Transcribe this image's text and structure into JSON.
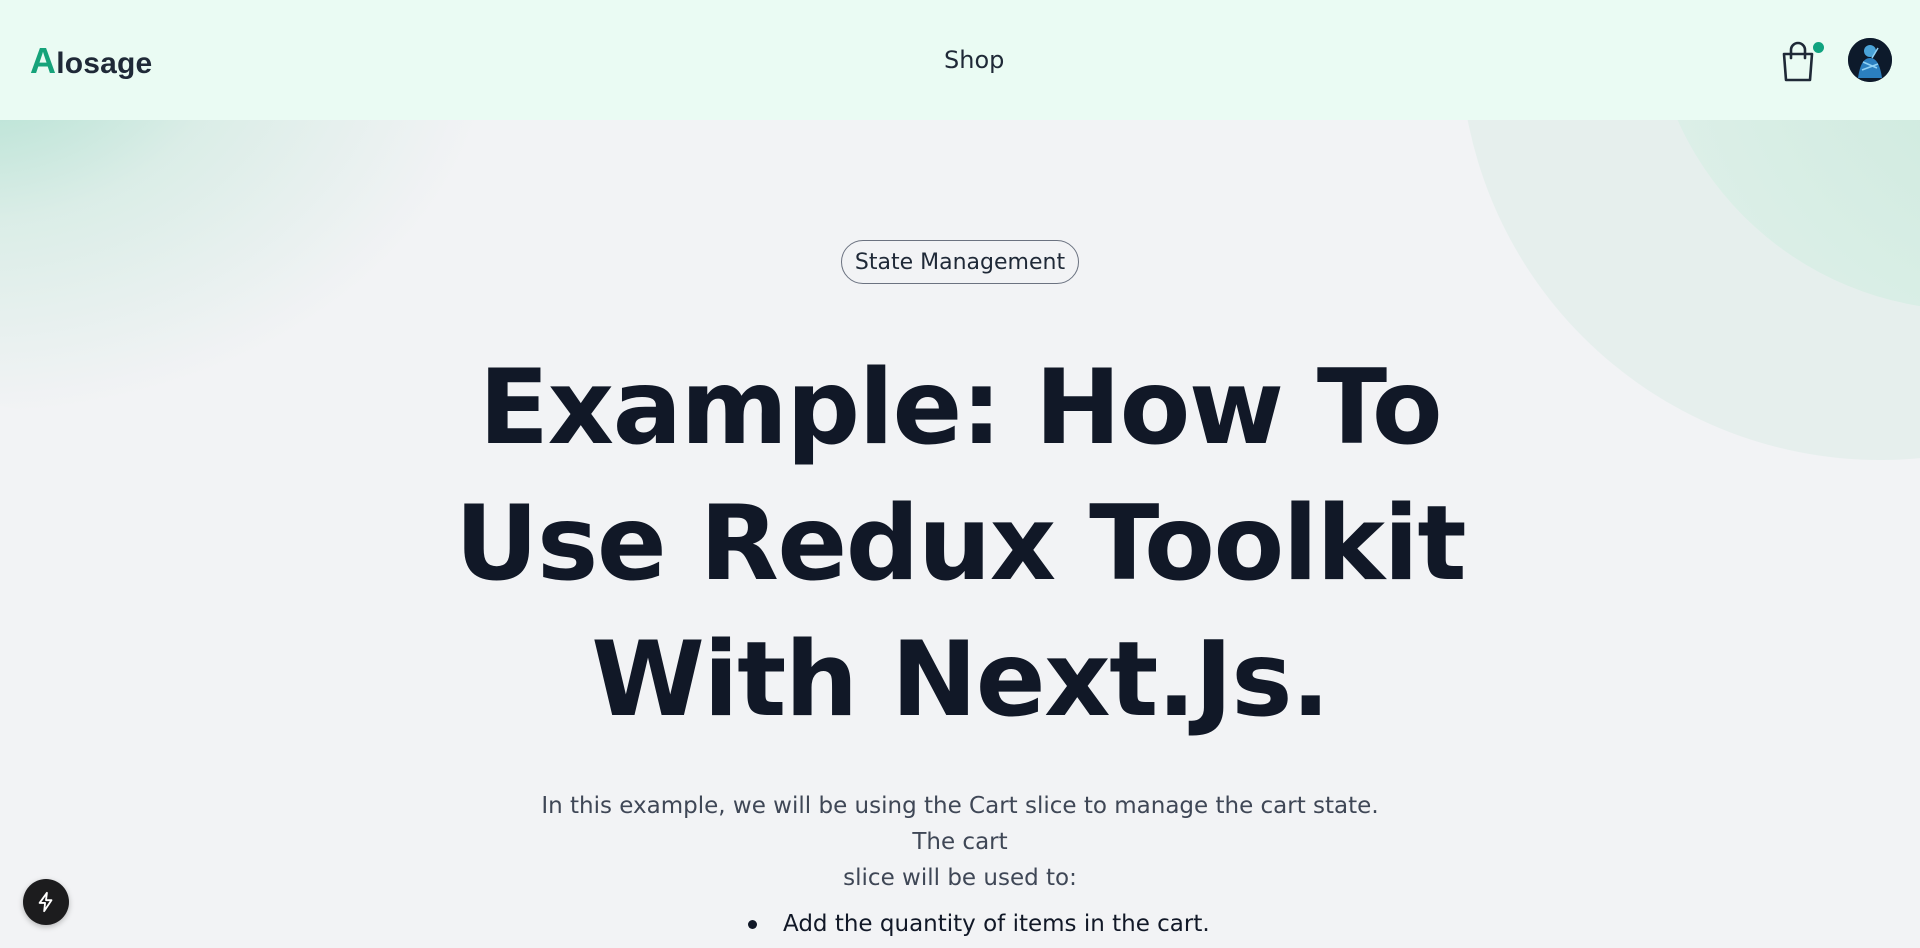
{
  "header": {
    "logo_mark": "A",
    "logo_rest": "losage",
    "nav_shop": "Shop",
    "cart_icon": "shopping-bag-icon",
    "avatar_icon": "user-avatar"
  },
  "hero": {
    "tag": "State Management",
    "title_line1": "Example: How To",
    "title_line2": "Use Redux Toolkit",
    "title_line3": "With Next.Js.",
    "intro_line1": "In this example, we will be using the Cart slice to manage the cart state. The cart",
    "intro_line2": "slice will be used to:",
    "bullets": [
      "Add the quantity of items in the cart."
    ]
  },
  "fab_icon": "lightning-icon",
  "colors": {
    "header_bg": "#eafbf3",
    "accent": "#16a37a",
    "badge": "#10a37f",
    "page_bg": "#f2f3f5",
    "title": "#111827"
  }
}
